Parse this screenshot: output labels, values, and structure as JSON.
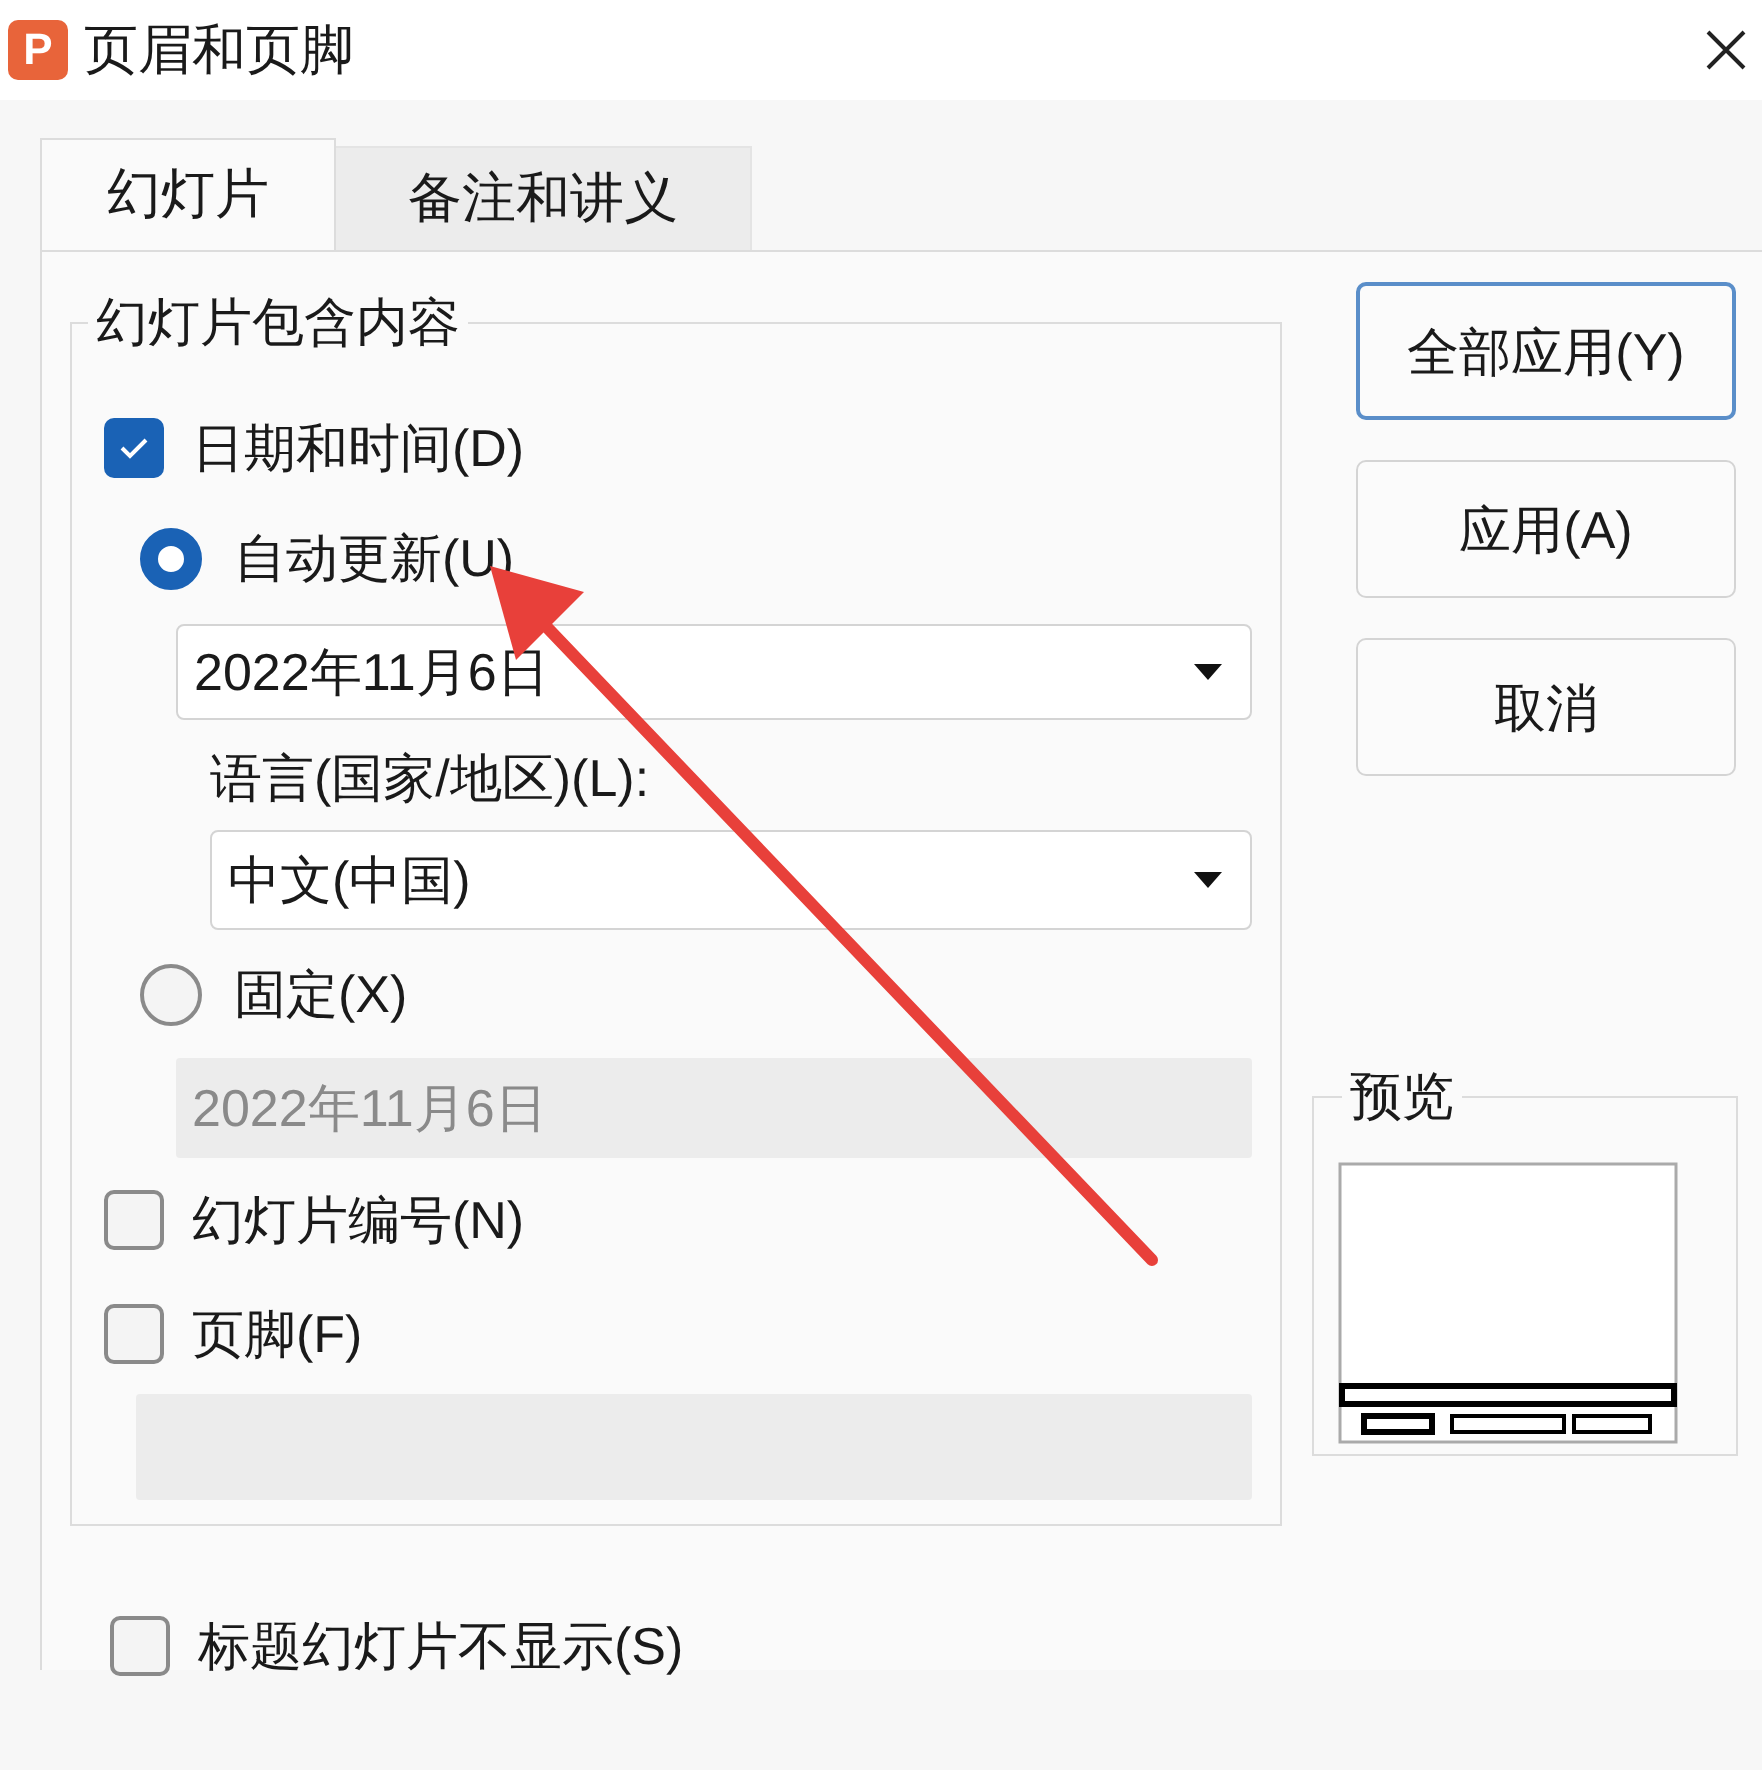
{
  "window": {
    "icon_text": "P",
    "title": "页眉和页脚"
  },
  "tabs": [
    {
      "label": "幻灯片",
      "selected": true
    },
    {
      "label": "备注和讲义",
      "selected": false
    }
  ],
  "group": {
    "title": "幻灯片包含内容",
    "items": [
      {
        "kind": "checkbox",
        "label": "日期和时间(D)",
        "checked": true
      },
      {
        "kind": "radio",
        "label": "自动更新(U)",
        "selected": true
      },
      {
        "kind": "dropdown",
        "value": "2022年11月6日"
      },
      {
        "kind": "label",
        "label": "语言(国家/地区)(L):"
      },
      {
        "kind": "dropdown",
        "value": "中文(中国)"
      },
      {
        "kind": "radio",
        "label": "固定(X)",
        "selected": false
      },
      {
        "kind": "field",
        "value": "2022年11月6日",
        "disabled": true
      },
      {
        "kind": "checkbox",
        "label": "幻灯片编号(N)",
        "checked": false
      },
      {
        "kind": "checkbox",
        "label": "页脚(F)",
        "checked": false
      },
      {
        "kind": "field",
        "disabled": true
      }
    ]
  },
  "title_slide_option": {
    "label": "标题幻灯片不显示(S)",
    "checked": false
  },
  "buttons": [
    {
      "label": "全部应用(Y)",
      "default": true
    },
    {
      "label": "应用(A)",
      "default": false
    },
    {
      "label": "取消",
      "default": false
    }
  ],
  "preview": {
    "title": "预览"
  }
}
